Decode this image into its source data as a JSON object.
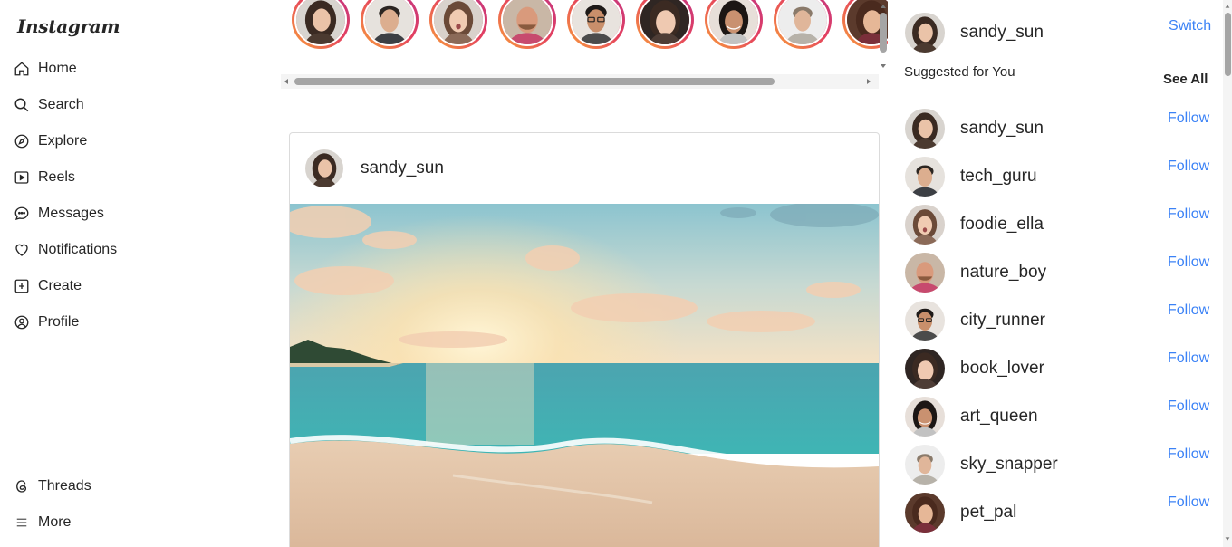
{
  "app": {
    "logo_text": "Instagram"
  },
  "sidebar": {
    "items": [
      {
        "label": "Home",
        "icon": "home-icon"
      },
      {
        "label": "Search",
        "icon": "search-icon"
      },
      {
        "label": "Explore",
        "icon": "compass-icon"
      },
      {
        "label": "Reels",
        "icon": "reels-icon"
      },
      {
        "label": "Messages",
        "icon": "messenger-icon"
      },
      {
        "label": "Notifications",
        "icon": "heart-icon"
      },
      {
        "label": "Create",
        "icon": "plus-square-icon"
      },
      {
        "label": "Profile",
        "icon": "user-circle-icon"
      }
    ],
    "bottom": [
      {
        "label": "Threads",
        "icon": "threads-icon"
      },
      {
        "label": "More",
        "icon": "hamburger-icon"
      }
    ]
  },
  "stories": {
    "count": 9,
    "ring_colors": [
      "#f9a13a",
      "#e4405f",
      "#c13584"
    ]
  },
  "post": {
    "username": "sandy_sun",
    "image": "beach-sunset"
  },
  "right": {
    "current_user": "sandy_sun",
    "switch_label": "Switch",
    "suggested_title": "Suggested for You",
    "see_all_label": "See All",
    "follow_label": "Follow",
    "suggestions": [
      {
        "username": "sandy_sun"
      },
      {
        "username": "tech_guru"
      },
      {
        "username": "foodie_ella"
      },
      {
        "username": "nature_boy"
      },
      {
        "username": "city_runner"
      },
      {
        "username": "book_lover"
      },
      {
        "username": "art_queen"
      },
      {
        "username": "sky_snapper"
      },
      {
        "username": "pet_pal"
      }
    ]
  },
  "colors": {
    "link": "#3b82f6",
    "text": "#262626",
    "border": "#dbdbdb"
  }
}
